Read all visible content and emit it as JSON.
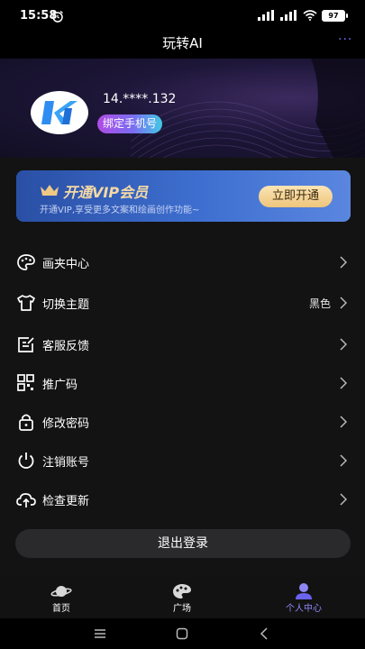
{
  "status": {
    "time": "15:58",
    "battery": "97"
  },
  "header": {
    "title": "玩转AI"
  },
  "profile": {
    "user_id": "14.****.132",
    "bind_phone_label": "绑定手机号"
  },
  "vip": {
    "title": "开通VIP会员",
    "description": "开通VIP,享受更多文案和绘画创作功能~",
    "button_label": "立即开通"
  },
  "menu": [
    {
      "label": "画夹中心",
      "value": "",
      "icon": "palette-icon"
    },
    {
      "label": "切换主题",
      "value": "黑色",
      "icon": "tshirt-icon"
    },
    {
      "label": "客服反馈",
      "value": "",
      "icon": "feedback-icon"
    },
    {
      "label": "推广码",
      "value": "",
      "icon": "qrcode-icon"
    },
    {
      "label": "修改密码",
      "value": "",
      "icon": "lock-icon"
    },
    {
      "label": "注销账号",
      "value": "",
      "icon": "power-icon"
    },
    {
      "label": "检查更新",
      "value": "",
      "icon": "cloud-upload-icon"
    }
  ],
  "logout_label": "退出登录",
  "tabs": [
    {
      "label": "首页",
      "icon": "planet-icon",
      "active": false
    },
    {
      "label": "广场",
      "icon": "palette-tab-icon",
      "active": false
    },
    {
      "label": "个人中心",
      "icon": "user-icon",
      "active": true
    }
  ],
  "colors": {
    "accent": "#7b73f2",
    "background": "#131313",
    "vip_gold": "#f0c983"
  }
}
